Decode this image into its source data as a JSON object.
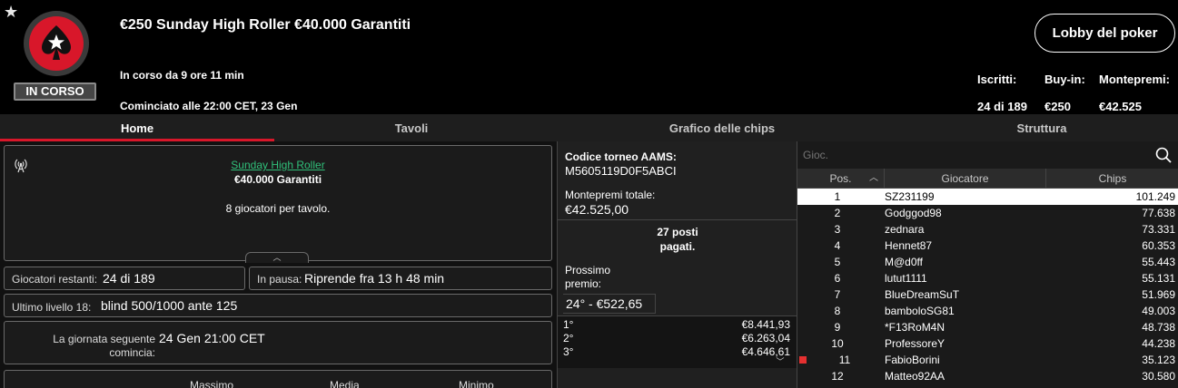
{
  "header": {
    "favorite_icon": "star-icon",
    "status": "IN CORSO",
    "title": "€250 Sunday High Roller €40.000 Garantiti",
    "running_for": "In corso da 9 ore 11 min",
    "started_at": "Cominciato alle 22:00 CET, 23 Gen",
    "lobby_button": "Lobby del poker",
    "stats": [
      {
        "label": "Iscritti:",
        "value": "24 di 189"
      },
      {
        "label": "Buy-in:",
        "value": "€250"
      },
      {
        "label": "Montepremi:",
        "value": "€42.525"
      }
    ]
  },
  "tabs": [
    {
      "label": "Home",
      "active": true
    },
    {
      "label": "Tavoli",
      "active": false
    },
    {
      "label": "Grafico delle chips",
      "active": false
    },
    {
      "label": "Struttura",
      "active": false
    }
  ],
  "summary": {
    "tournament_link": "Sunday High Roller",
    "guaranteed": "€40.000 Garantiti",
    "table_info": "8 giocatori per tavolo.",
    "players_left_label": "Giocatori restanti:",
    "players_left_value": "24 di 189",
    "pause_label": "In pausa:",
    "pause_value": "Riprende fra 13 h 48 min",
    "last_level_label": "Ultimo livello 18:",
    "last_level_value": "blind 500/1000 ante 125",
    "next_day_label": "La giornata seguente comincia:",
    "next_day_value": "24 Gen 21:00 CET",
    "columns": [
      "Massimo",
      "Media",
      "Minimo"
    ]
  },
  "prize": {
    "aams_label": "Codice torneo AAMS:",
    "aams_code": "M5605119D0F5ABCI",
    "total_label": "Montepremi totale:",
    "total_value": "€42.525,00",
    "paid_places": "27 posti pagati.",
    "next_label": "Prossimo premio:",
    "next_value": "24° - €522,65",
    "list": [
      {
        "pos": "1°",
        "amount": "€8.441,93"
      },
      {
        "pos": "2°",
        "amount": "€6.263,04"
      },
      {
        "pos": "3°",
        "amount": "€4.646,61"
      }
    ]
  },
  "players": {
    "search_placeholder": "Gioc.",
    "headers": {
      "pos": "Pos.",
      "player": "Giocatore",
      "chips": "Chips"
    },
    "rows": [
      {
        "pos": "1",
        "name": "SZ231199",
        "chips": "101.249",
        "selected": true
      },
      {
        "pos": "2",
        "name": "Godggod98",
        "chips": "77.638"
      },
      {
        "pos": "3",
        "name": "zednara",
        "chips": "73.331"
      },
      {
        "pos": "4",
        "name": "Hennet87",
        "chips": "60.353"
      },
      {
        "pos": "5",
        "name": "M@d0ff",
        "chips": "55.443"
      },
      {
        "pos": "6",
        "name": "lutut1111",
        "chips": "55.131"
      },
      {
        "pos": "7",
        "name": "BlueDreamSuT",
        "chips": "51.969"
      },
      {
        "pos": "8",
        "name": "bamboloSG81",
        "chips": "49.003"
      },
      {
        "pos": "9",
        "name": "*F13RoM4N",
        "chips": "48.738"
      },
      {
        "pos": "10",
        "name": "ProfessoreY",
        "chips": "44.238"
      },
      {
        "pos": "11",
        "name": "FabioBorini",
        "chips": "35.123",
        "marker": true
      },
      {
        "pos": "12",
        "name": "Matteo92AA",
        "chips": "30.580"
      }
    ]
  }
}
